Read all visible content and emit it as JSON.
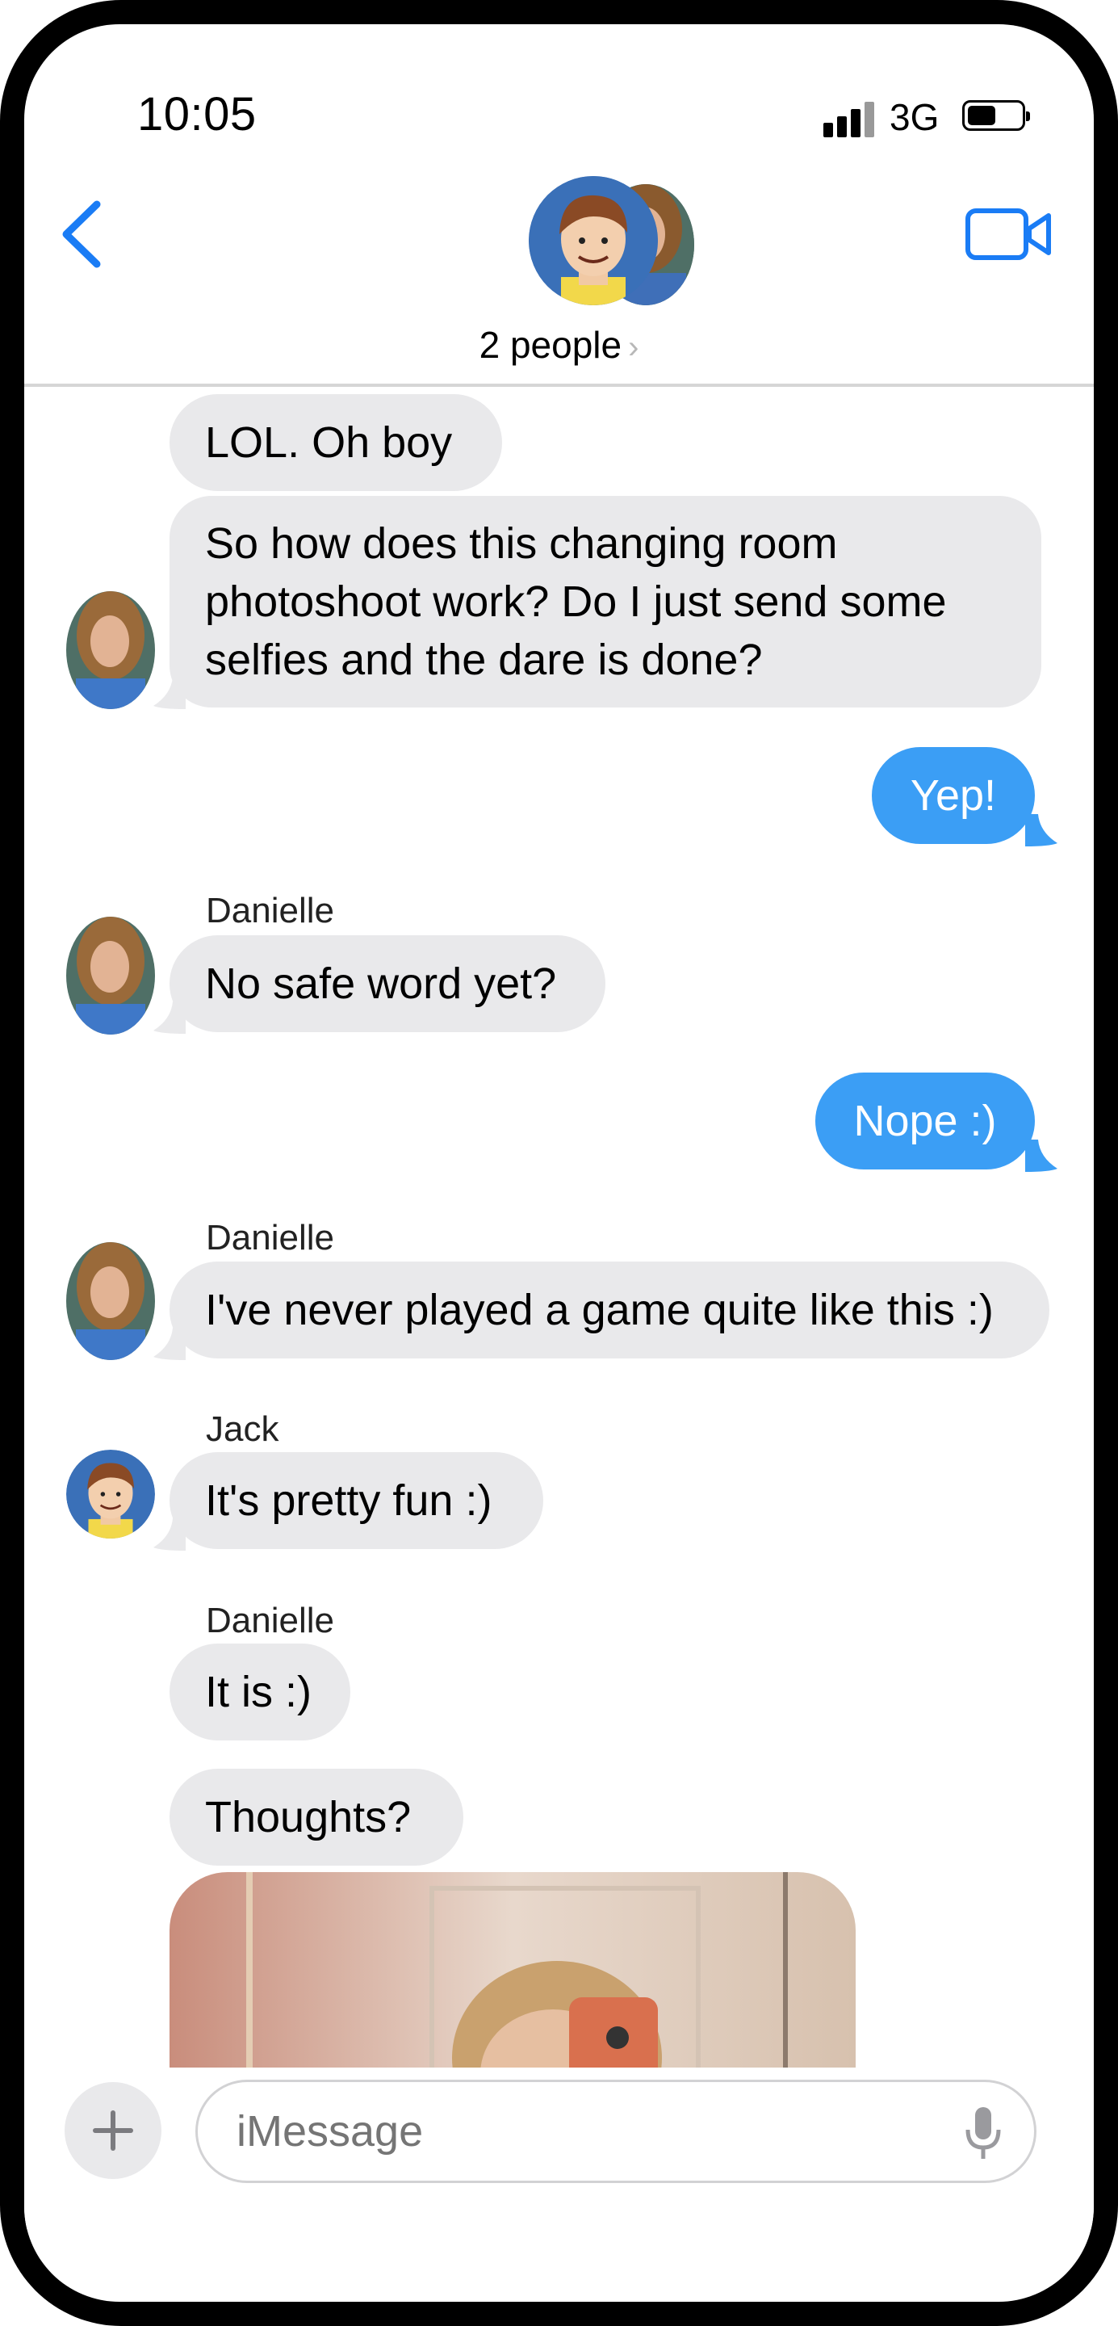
{
  "status_bar": {
    "time": "10:05",
    "network": "3G"
  },
  "header": {
    "participants": "2 people",
    "chevron": "›"
  },
  "messages": [
    {
      "dir": "in",
      "text": "LOL.  Oh boy"
    },
    {
      "dir": "in",
      "text": "So how does this changing room photoshoot work?  Do I just send some selfies and the dare is done?"
    },
    {
      "dir": "out",
      "text": "Yep!"
    },
    {
      "dir": "in",
      "sender": "Danielle",
      "text": "No safe word yet?"
    },
    {
      "dir": "out",
      "text": "Nope :)"
    },
    {
      "dir": "in",
      "sender": "Danielle",
      "text": "I've never played a game quite like this :)"
    },
    {
      "dir": "in",
      "sender": "Jack",
      "text": "It's pretty fun :)"
    },
    {
      "dir": "in",
      "sender": "Danielle",
      "text": "It is :)"
    },
    {
      "dir": "in",
      "text": "Thoughts?"
    }
  ],
  "composer": {
    "placeholder": "iMessage",
    "plus_icon": "+"
  },
  "icons": {
    "back": "chevron-left-icon",
    "video": "video-camera-icon",
    "mic": "microphone-icon",
    "plus": "plus-icon"
  },
  "colors": {
    "accent": "#1a7cf5",
    "outgoing": "#3b9ef5",
    "incoming": "#e9e9eb"
  }
}
